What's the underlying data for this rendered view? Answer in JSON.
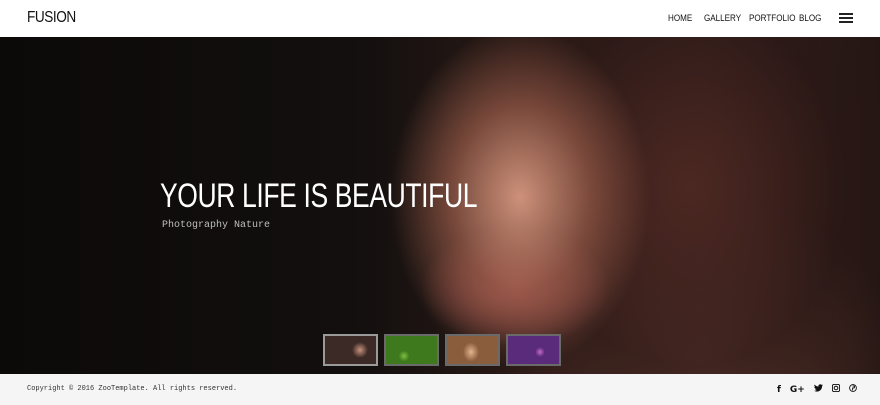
{
  "header": {
    "logo": "FUSION",
    "nav": [
      {
        "label": "HOME"
      },
      {
        "label": "GALLERY"
      },
      {
        "label": "PORTFOLIO"
      },
      {
        "label": "BLOG"
      }
    ],
    "menu_icon": "hamburger-icon"
  },
  "hero": {
    "title": "YOUR LIFE IS BEAUTIFUL",
    "subtitle": "Photography Nature",
    "thumbnails": [
      {
        "icon": "portrait-thumbnail",
        "active": true
      },
      {
        "icon": "green-fruit-thumbnail",
        "active": false
      },
      {
        "icon": "blonde-portrait-thumbnail",
        "active": false
      },
      {
        "icon": "purple-flower-thumbnail",
        "active": false
      }
    ]
  },
  "footer": {
    "copyright": "Copyright © 2016 ZooTemplate. All rights reserved.",
    "social": [
      {
        "icon": "facebook-icon",
        "glyph": "f"
      },
      {
        "icon": "google-plus-icon",
        "glyph": "G+"
      },
      {
        "icon": "twitter-icon",
        "glyph": "🐦"
      },
      {
        "icon": "instagram-icon",
        "glyph": "◙"
      },
      {
        "icon": "pinterest-icon",
        "glyph": "℗"
      }
    ]
  }
}
